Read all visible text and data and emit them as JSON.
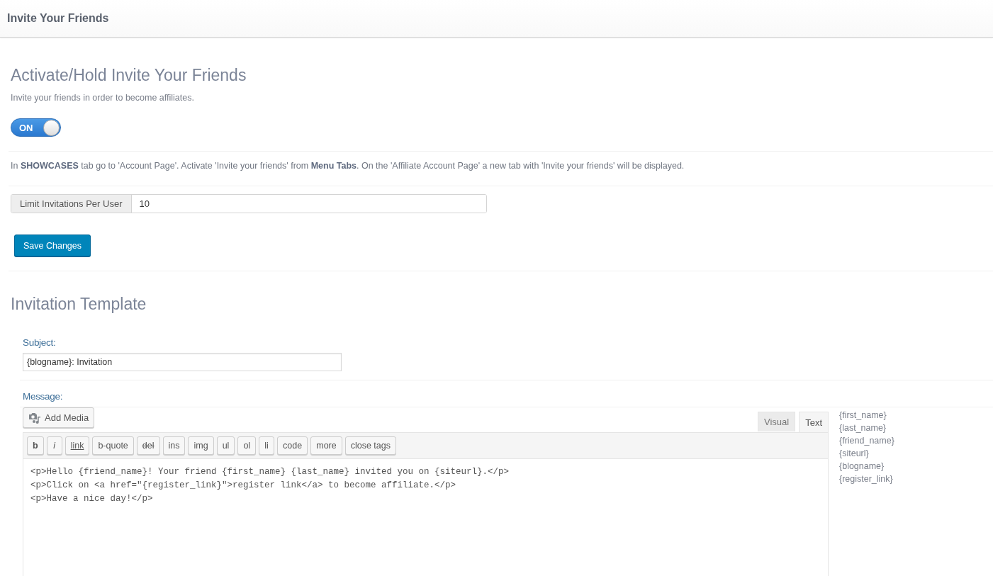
{
  "header": {
    "title": "Invite Your Friends"
  },
  "activation": {
    "heading": "Activate/Hold Invite Your Friends",
    "description": "Invite your friends in order to become affiliates.",
    "toggle": {
      "label": "ON",
      "on": true
    }
  },
  "instructions": "In **SHOWCASES** tab go to 'Account Page'. Activate 'Invite your friends' from **Menu Tabs**. On the 'Affiliate Account Page' a new tab with 'Invite your friends' will be displayed.",
  "limit_field": {
    "label": "Limit Invitations Per User",
    "value": "10"
  },
  "save_button": "Save Changes",
  "template": {
    "heading": "Invitation Template",
    "subject": {
      "label": "Subject:",
      "value": "{blogname}: Invitation"
    },
    "message": {
      "label": "Message:",
      "add_media": "Add Media",
      "tabs": [
        {
          "label": "Visual",
          "selected": false
        },
        {
          "label": "Text",
          "selected": true
        }
      ],
      "quicktags": [
        {
          "label": "b",
          "kind": "bold"
        },
        {
          "label": "i",
          "kind": "italic"
        },
        {
          "label": "link",
          "kind": "underline"
        },
        {
          "label": "b-quote",
          "kind": "plain"
        },
        {
          "label": "del",
          "kind": "strike"
        },
        {
          "label": "ins",
          "kind": "plain"
        },
        {
          "label": "img",
          "kind": "plain"
        },
        {
          "label": "ul",
          "kind": "plain"
        },
        {
          "label": "ol",
          "kind": "plain"
        },
        {
          "label": "li",
          "kind": "plain"
        },
        {
          "label": "code",
          "kind": "plain"
        },
        {
          "label": "more",
          "kind": "plain"
        },
        {
          "label": "close tags",
          "kind": "plain"
        }
      ],
      "content": [
        "<p>Hello {friend_name}! Your friend {first_name} {last_name} invited you on {siteurl}.</p>",
        "<p>Click on <a href=\"{register_link}\">register link</a> to become affiliate.</p>",
        "<p>Have a nice day!</p>"
      ]
    },
    "placeholders": [
      "{first_name}",
      "{last_name}",
      "{friend_name}",
      "{siteurl}",
      "{blogname}",
      "{register_link}"
    ]
  }
}
